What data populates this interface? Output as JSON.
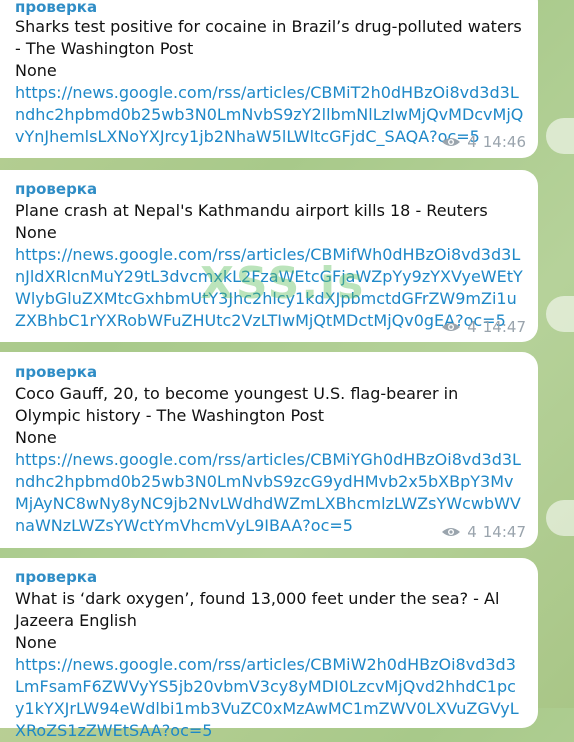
{
  "watermark": "XSS.is",
  "messages": [
    {
      "sender": "проверка",
      "title": "Sharks test positive for cocaine in Brazil’s drug-polluted waters - The Washington Post",
      "extra": "None",
      "url": "https://news.google.com/rss/articles/CBMiT2h0dHBzOi8vd3d3Lndhc2hpbmd0b25wb3N0LmNvbS9zY2llbmNlLzIwMjQvMDcvMjQvYnJhemlsLXNoYXJrcy1jb2NhaW5lLWltcGFjdC_SAQA?oc=5",
      "views": "4",
      "time": "14:46"
    },
    {
      "sender": "проверка",
      "title": "Plane crash at Nepal's Kathmandu airport kills 18 - Reuters",
      "extra": "None",
      "url": "https://news.google.com/rss/articles/CBMifWh0dHBzOi8vd3d3LnJldXRlcnMuY29tL3dvcmxkL2FzaWEtcGFjaWZpYy9zYXVyeWEtYWlybGluZXMtcGxhbmUtY3Jhc2hlcy1kdXJpbmctdGFrZW9mZi1uZXBhbC1rYXRobWFuZHUtc2VzLTIwMjQtMDctMjQv0gEA?oc=5",
      "views": "4",
      "time": "14:47"
    },
    {
      "sender": "проверка",
      "title": "Coco Gauff, 20, to become youngest U.S. flag-bearer in Olympic history - The Washington Post",
      "extra": "None",
      "url": "https://news.google.com/rss/articles/CBMiYGh0dHBzOi8vd3d3Lndhc2hpbmd0b25wb3N0LmNvbS9zcG9ydHMvb2x5bXBpY3MvMjAyNC8wNy8yNC9jb2NvLWdhdWZmLXBhcmlzLWZsYWcwbWVnaWNzLWZsYWctYmVhcmVyL9IBAA?oc=5",
      "views": "4",
      "time": "14:47"
    },
    {
      "sender": "проверка",
      "title": "What is ‘dark oxygen’, found 13,000 feet under the sea? - Al Jazeera English",
      "extra": "None",
      "url": "https://news.google.com/rss/articles/CBMiW2h0dHBzOi8vd3d3LmFsamF6ZWVyYS5jb20vbmV3cy8yMDI0LzcvMjQvd2hhdC1pcy1kYXJrLW94eWdlbi1mb3VuZC0xMzAwMC1mZWV0LXVuZGVyLXRoZS1zZWEtSAA?oc=5",
      "views": "",
      "time": ""
    }
  ]
}
